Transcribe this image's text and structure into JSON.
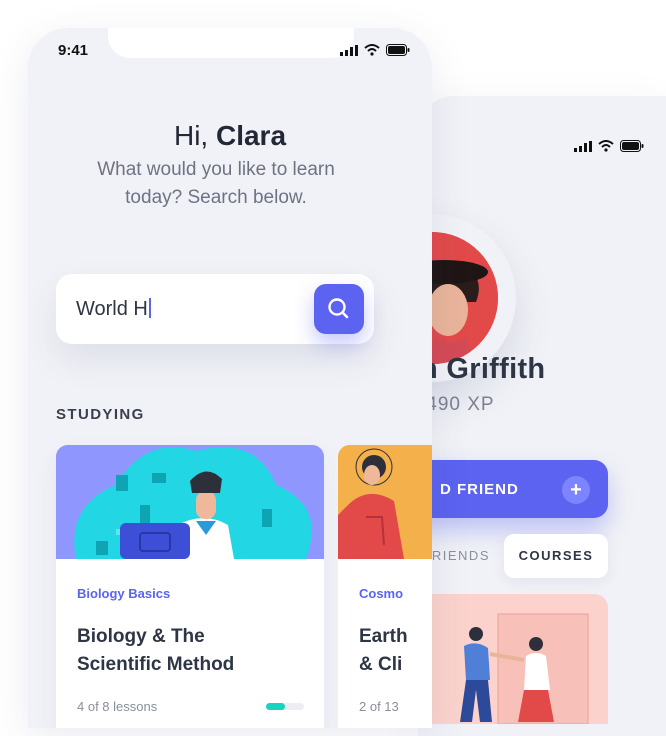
{
  "colors": {
    "accent": "#5b63f0",
    "progress": "#16d4c0",
    "background": "#f1f2f7",
    "heading": "#2e3544"
  },
  "phone_main": {
    "status": {
      "time": "9:41",
      "icons": [
        "signal-icon",
        "wifi-icon",
        "battery-icon"
      ]
    },
    "greeting": {
      "prefix": "Hi, ",
      "name": "Clara"
    },
    "subtitle_line1": "What would you like to learn",
    "subtitle_line2": "today? Search below.",
    "search": {
      "value": "World H",
      "icon": "search-icon"
    },
    "section_label": "STUDYING",
    "cards": [
      {
        "category": "Biology Basics",
        "title_line1": "Biology & The",
        "title_line2": "Scientific Method",
        "progress_text": "4 of 8 lessons",
        "progress_fraction": 0.5
      },
      {
        "category": "Cosmo",
        "title_line1": "Earth",
        "title_line2": "& Cli",
        "progress_text": "2 of 13"
      }
    ]
  },
  "phone_profile": {
    "status_icons": [
      "signal-icon",
      "wifi-icon",
      "battery-icon"
    ],
    "name": "h Griffith",
    "xp": ",490 XP",
    "add_button_label": "D FRIEND",
    "add_button_icon": "plus-icon",
    "tabs": [
      {
        "label": "RIENDS",
        "active": false
      },
      {
        "label": "COURSES",
        "active": true
      }
    ]
  }
}
